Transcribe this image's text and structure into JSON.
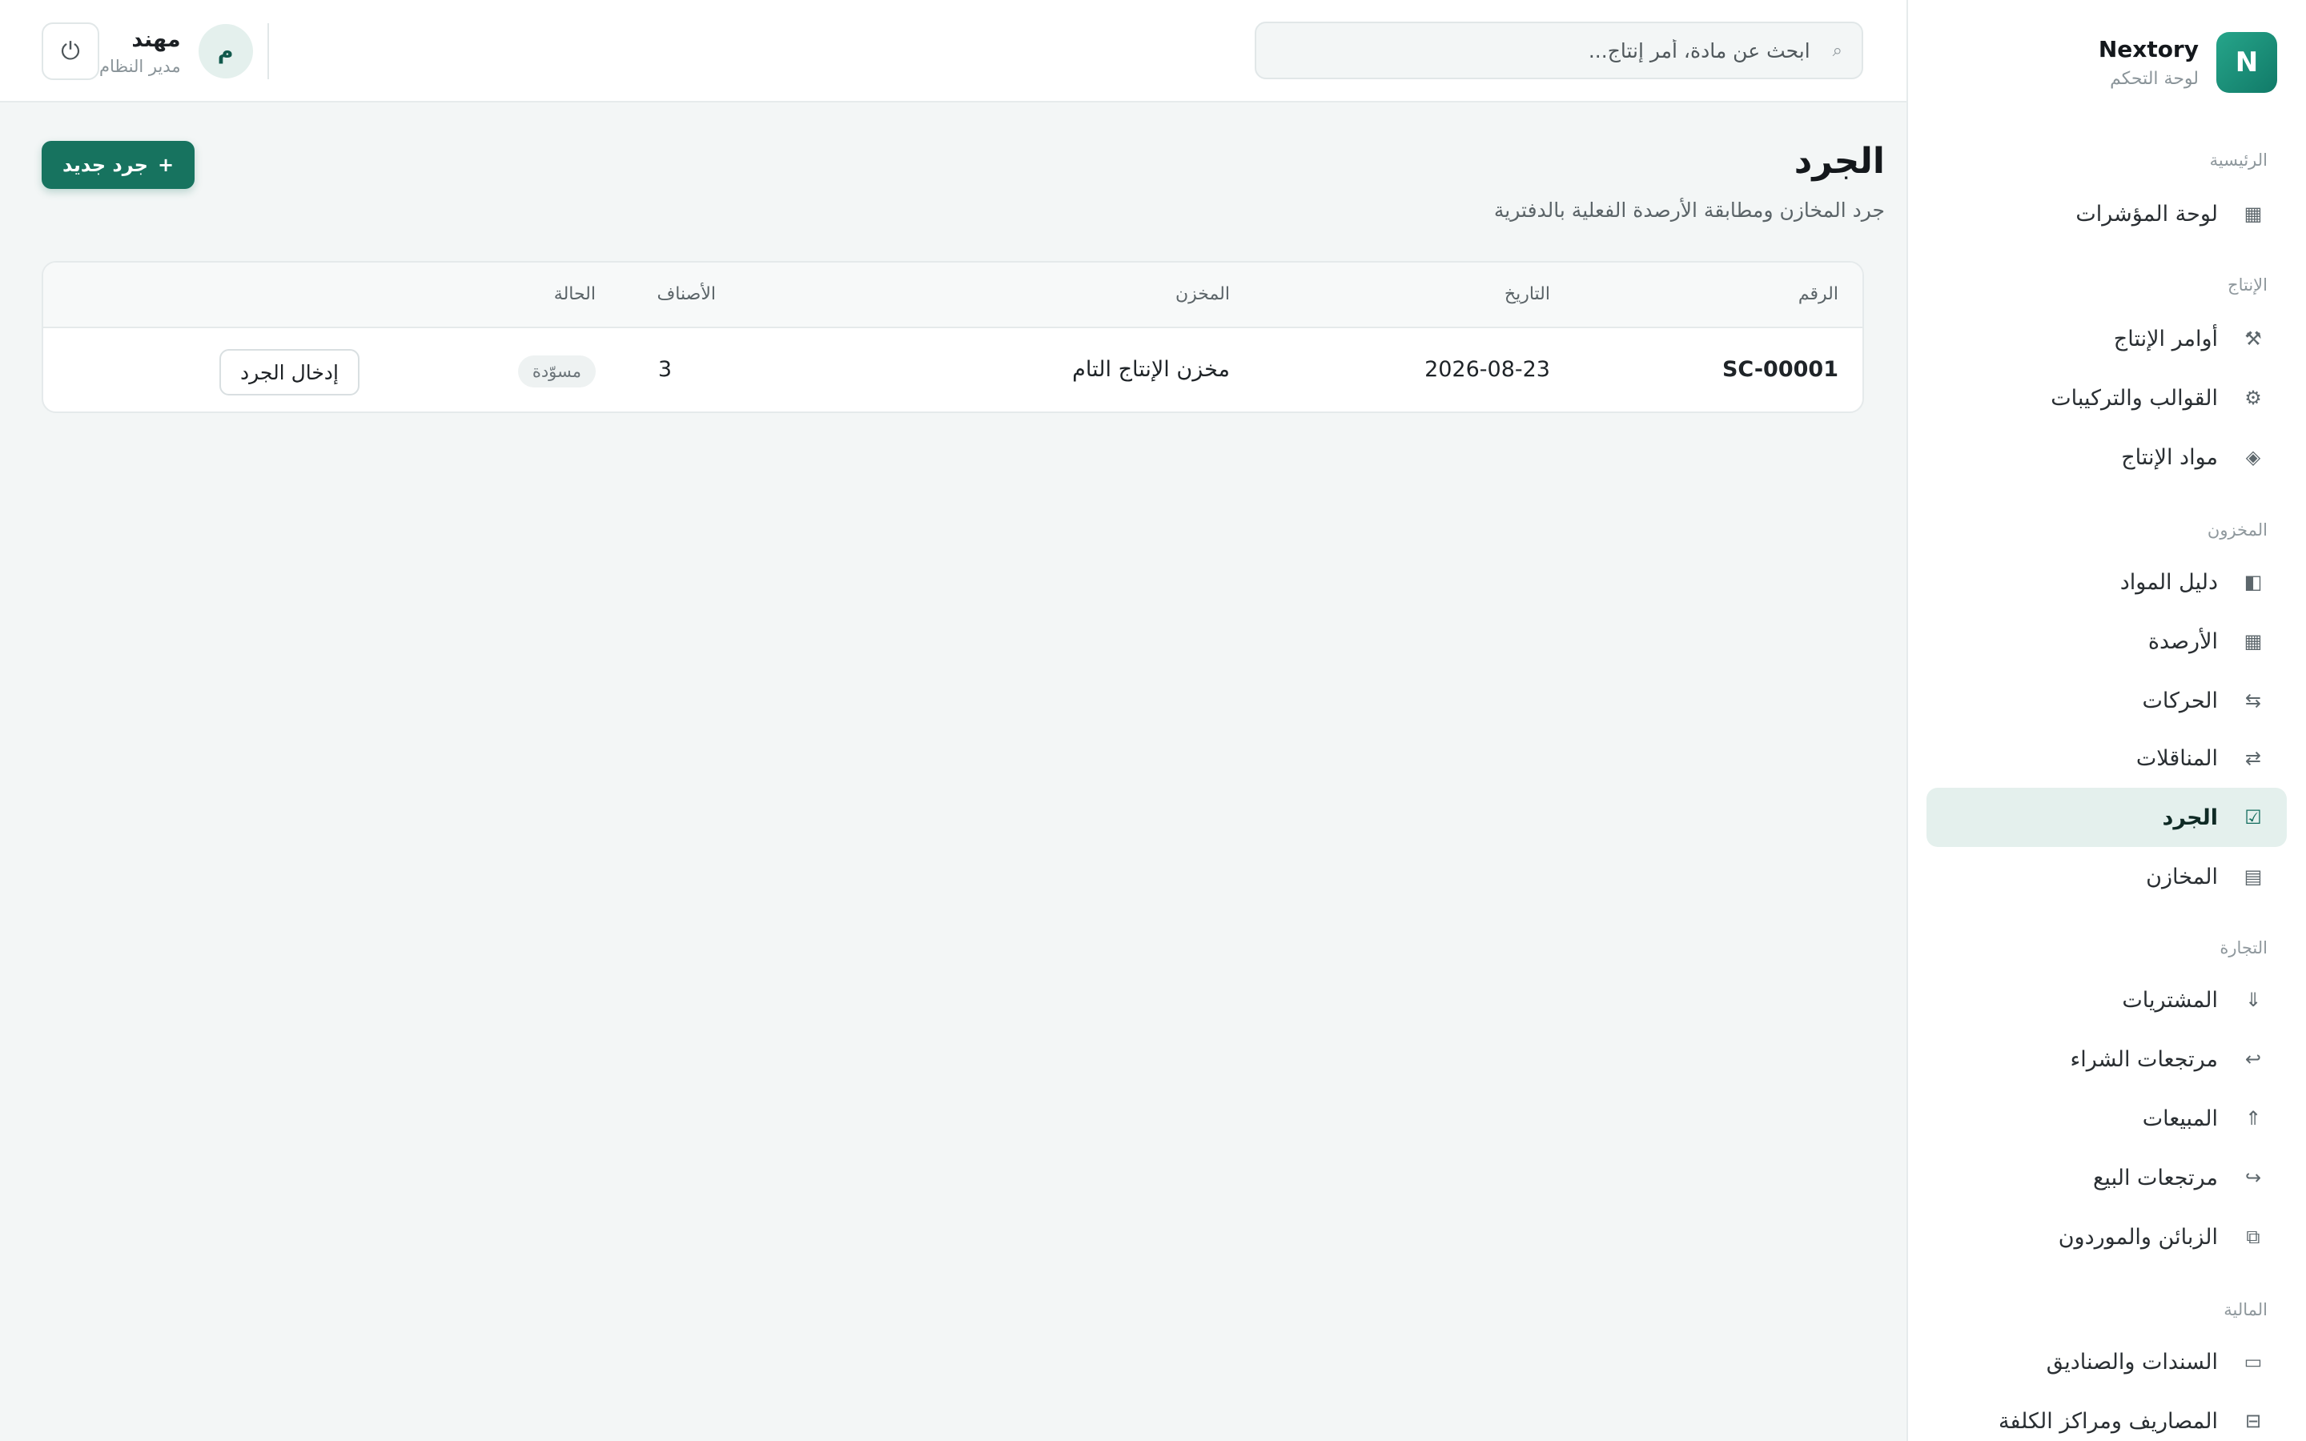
{
  "brand": {
    "logo_letter": "N",
    "name": "Nextory",
    "subtitle": "لوحة التحكم"
  },
  "sidebar": {
    "groups": [
      {
        "label": "الرئيسية",
        "items": [
          {
            "label": "لوحة المؤشرات",
            "icon": "grid-icon"
          }
        ]
      },
      {
        "label": "الإنتاج",
        "items": [
          {
            "label": "أوامر الإنتاج",
            "icon": "worker-icon"
          },
          {
            "label": "القوالب والتركيبات",
            "icon": "gear-icon"
          },
          {
            "label": "مواد الإنتاج",
            "icon": "diamond-icon"
          }
        ]
      },
      {
        "label": "المخزون",
        "items": [
          {
            "label": "دليل المواد",
            "icon": "book-icon"
          },
          {
            "label": "الأرصدة",
            "icon": "grid-icon"
          },
          {
            "label": "الحركات",
            "icon": "movements-icon"
          },
          {
            "label": "المناقلات",
            "icon": "transfer-icon"
          },
          {
            "label": "الجرد",
            "icon": "checkbox-icon",
            "active": true
          },
          {
            "label": "المخازن",
            "icon": "warehouse-icon"
          }
        ]
      },
      {
        "label": "التجارة",
        "items": [
          {
            "label": "المشتريات",
            "icon": "arrow-down-icon"
          },
          {
            "label": "مرتجعات الشراء",
            "icon": "return-icon"
          },
          {
            "label": "المبيعات",
            "icon": "arrow-up-icon"
          },
          {
            "label": "مرتجعات البيع",
            "icon": "return-forward-icon"
          },
          {
            "label": "الزبائن والموردون",
            "icon": "contacts-icon"
          }
        ]
      },
      {
        "label": "المالية",
        "items": [
          {
            "label": "السندات والصناديق",
            "icon": "cash-icon"
          },
          {
            "label": "المصاريف ومراكز الكلفة",
            "icon": "ledger-icon"
          }
        ]
      }
    ]
  },
  "topbar": {
    "search_placeholder": "ابحث عن مادة، أمر إنتاج...",
    "user": {
      "initial": "م",
      "name": "مهند",
      "role": "مدير النظام"
    }
  },
  "page": {
    "title": "الجرد",
    "subtitle": "جرد المخازن ومطابقة الأرصدة الفعلية بالدفترية",
    "new_button_label": "جرد جديد",
    "new_button_icon": "+"
  },
  "table": {
    "headers": {
      "code": "الرقم",
      "date": "التاريخ",
      "warehouse": "المخزن",
      "items": "الأصناف",
      "status": "الحالة"
    },
    "rows": [
      {
        "code": "SC-00001",
        "date": "2026-08-23",
        "warehouse": "مخزن الإنتاج التام",
        "items": "3",
        "status": "مسوّدة",
        "action": "إدخال الجرد"
      }
    ]
  },
  "colors": {
    "accent": "#17735f",
    "active_bg": "#e4f0ed",
    "background": "#f3f6f6"
  }
}
